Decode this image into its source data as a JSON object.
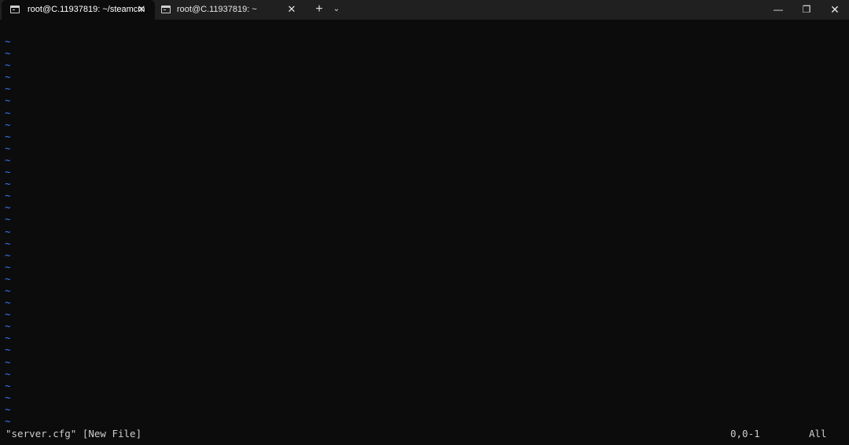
{
  "tabs": [
    {
      "title": "root@C.11937819: ~/steamcm",
      "active": true
    },
    {
      "title": "root@C.11937819: ~",
      "active": false
    }
  ],
  "titlebar": {
    "new_tab_icon": "plus-icon",
    "dropdown_icon": "chevron-down-icon",
    "close_glyph": "✕",
    "plus_glyph": "+",
    "chevron_glyph": "⌄",
    "minimize_glyph": "—",
    "maximize_glyph": "❐",
    "window_close_glyph": "✕"
  },
  "editor": {
    "empty_line_marker": "~",
    "empty_line_count": 33,
    "status_message": "\"server.cfg\" [New File]",
    "cursor_position": "0,0-1",
    "scroll_percent": "All"
  },
  "colors": {
    "terminal_bg": "#0c0c0c",
    "titlebar_bg": "#202020",
    "tilde": "#3b78ff",
    "text": "#cccccc"
  }
}
